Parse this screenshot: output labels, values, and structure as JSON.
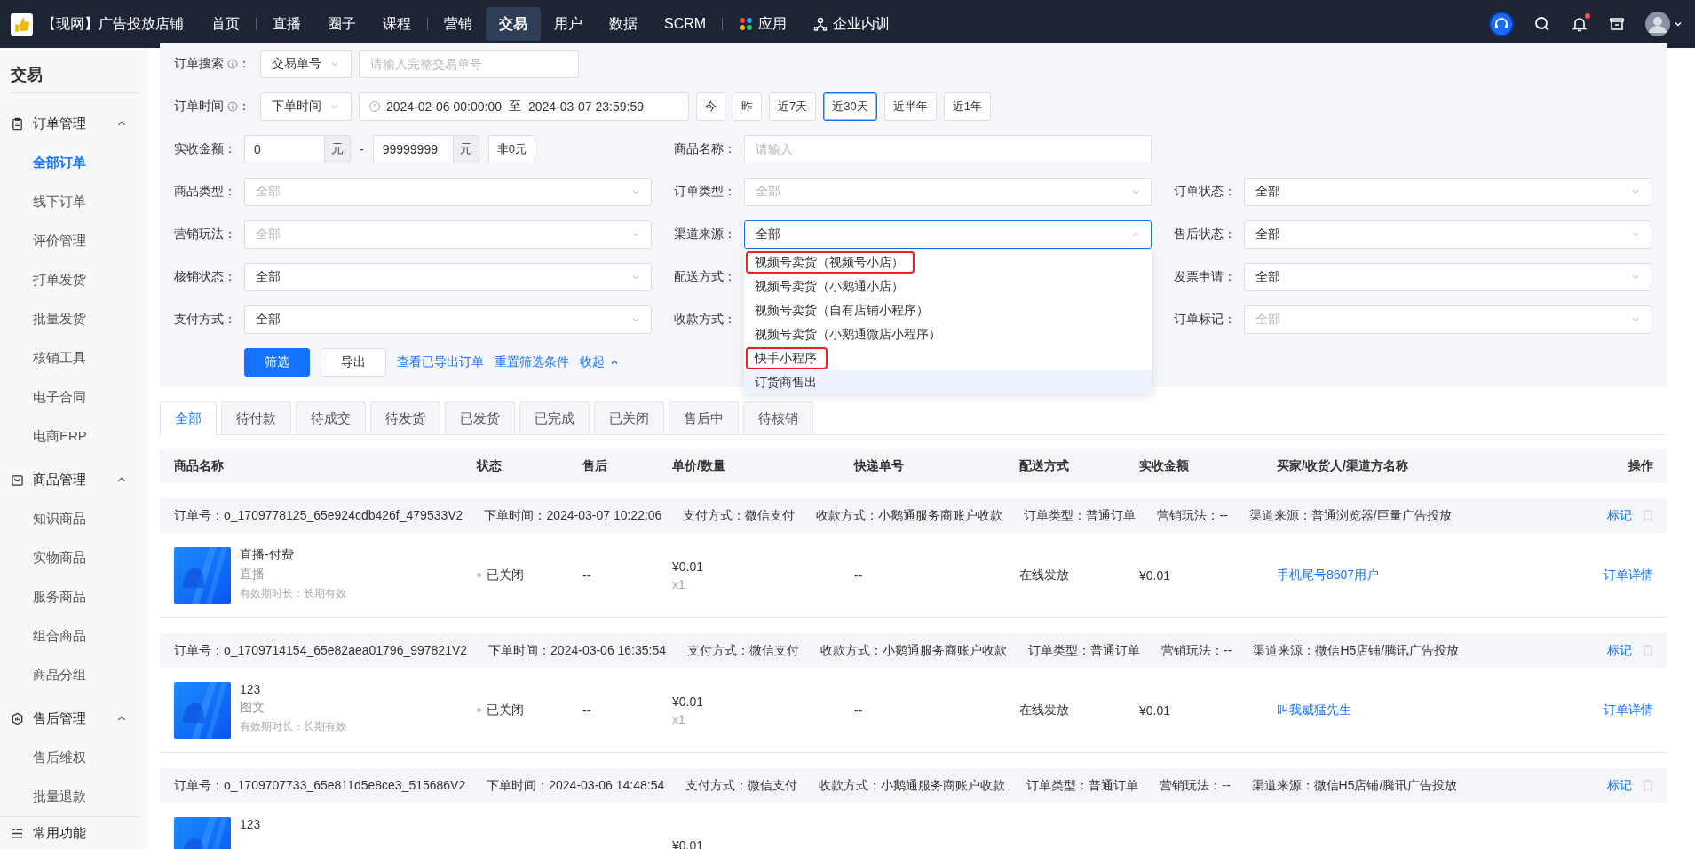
{
  "topbar": {
    "store_name": "【现网】广告投放店铺",
    "nav": [
      {
        "label": "首页",
        "selected": false,
        "divider_after": true,
        "kind": "text"
      },
      {
        "label": "直播",
        "selected": false,
        "divider_after": false,
        "kind": "text"
      },
      {
        "label": "圈子",
        "selected": false,
        "divider_after": false,
        "kind": "text"
      },
      {
        "label": "课程",
        "selected": false,
        "divider_after": true,
        "kind": "text"
      },
      {
        "label": "营销",
        "selected": false,
        "divider_after": false,
        "kind": "text"
      },
      {
        "label": "交易",
        "selected": true,
        "divider_after": false,
        "kind": "text"
      },
      {
        "label": "用户",
        "selected": false,
        "divider_after": false,
        "kind": "text"
      },
      {
        "label": "数据",
        "selected": false,
        "divider_after": false,
        "kind": "text"
      },
      {
        "label": "SCRM",
        "selected": false,
        "divider_after": true,
        "kind": "text"
      },
      {
        "label": "应用",
        "selected": false,
        "divider_after": false,
        "kind": "apps"
      },
      {
        "label": "企业内训",
        "selected": false,
        "divider_after": false,
        "kind": "training"
      }
    ],
    "notification_dot": true
  },
  "sidebar": {
    "title": "交易",
    "groups": [
      {
        "label": "订单管理",
        "expanded": true,
        "items": [
          {
            "label": "全部订单",
            "selected": true
          },
          {
            "label": "线下订单",
            "selected": false
          },
          {
            "label": "评价管理",
            "selected": false
          },
          {
            "label": "打单发货",
            "selected": false
          },
          {
            "label": "批量发货",
            "selected": false
          },
          {
            "label": "核销工具",
            "selected": false
          },
          {
            "label": "电子合同",
            "selected": false
          },
          {
            "label": "电商ERP",
            "selected": false
          }
        ]
      },
      {
        "label": "商品管理",
        "expanded": true,
        "items": [
          {
            "label": "知识商品",
            "selected": false
          },
          {
            "label": "实物商品",
            "selected": false
          },
          {
            "label": "服务商品",
            "selected": false
          },
          {
            "label": "组合商品",
            "selected": false
          },
          {
            "label": "商品分组",
            "selected": false
          }
        ]
      },
      {
        "label": "售后管理",
        "expanded": true,
        "items": [
          {
            "label": "售后维权",
            "selected": false
          },
          {
            "label": "批量退款",
            "selected": false
          }
        ]
      }
    ],
    "footer": "常用功能"
  },
  "filters": {
    "order_search": {
      "label": "订单搜索",
      "colon": "：",
      "type_select": "交易单号",
      "placeholder": "请输入完整交易单号"
    },
    "order_time": {
      "label": "订单时间",
      "colon": "：",
      "type_select": "下单时间",
      "start": "2024-02-06 00:00:00",
      "separator": "至",
      "end": "2024-03-07 23:59:59",
      "quick": [
        {
          "label": "今",
          "selected": false
        },
        {
          "label": "昨",
          "selected": false
        },
        {
          "label": "近7天",
          "selected": false
        },
        {
          "label": "近30天",
          "selected": true
        },
        {
          "label": "近半年",
          "selected": false
        },
        {
          "label": "近1年",
          "selected": false
        }
      ]
    },
    "amount": {
      "label": "实收金额：",
      "min": "0",
      "min_unit": "元",
      "dash": "-",
      "max": "99999999",
      "max_unit": "元",
      "nonzero": "非0元"
    },
    "product_name": {
      "label": "商品名称：",
      "placeholder": "请输入"
    },
    "selects": [
      {
        "label": "商品类型：",
        "placeholder": "全部",
        "open": false
      },
      {
        "label": "订单类型：",
        "placeholder": "全部",
        "open": false
      },
      {
        "label": "订单状态：",
        "value": "全部",
        "open": false
      },
      {
        "label": "营销玩法：",
        "placeholder": "全部",
        "open": false
      },
      {
        "label": "渠道来源：",
        "value": "全部",
        "open": true
      },
      {
        "label": "售后状态：",
        "value": "全部",
        "open": false
      },
      {
        "label": "核销状态：",
        "value": "全部",
        "open": false
      },
      {
        "label": "配送方式："
      },
      {
        "label": "发票申请：",
        "value": "全部",
        "open": false
      },
      {
        "label": "支付方式：",
        "value": "全部",
        "open": false
      },
      {
        "label": "收款方式："
      },
      {
        "label": "订单标记：",
        "placeholder": "全部",
        "open": false
      }
    ],
    "dropdown": {
      "options": [
        {
          "label": "视频号卖货（视频号小店）",
          "highlighted": true,
          "hovered": false
        },
        {
          "label": "视频号卖货（小鹅通小店）",
          "highlighted": false,
          "hovered": false
        },
        {
          "label": "视频号卖货（自有店铺小程序）",
          "highlighted": false,
          "hovered": false
        },
        {
          "label": "视频号卖货（小鹅通微店小程序）",
          "highlighted": false,
          "hovered": false
        },
        {
          "label": "快手小程序",
          "highlighted": true,
          "hovered": false
        },
        {
          "label": "订货商售出",
          "highlighted": false,
          "hovered": true
        }
      ]
    },
    "actions": {
      "filter": "筛选",
      "export": "导出",
      "links": [
        "查看已导出订单",
        "重置筛选条件"
      ],
      "collapse": "收起"
    }
  },
  "tabs": [
    {
      "label": "全部",
      "selected": true
    },
    {
      "label": "待付款",
      "selected": false
    },
    {
      "label": "待成交",
      "selected": false
    },
    {
      "label": "待发货",
      "selected": false
    },
    {
      "label": "已发货",
      "selected": false
    },
    {
      "label": "已完成",
      "selected": false
    },
    {
      "label": "已关闭",
      "selected": false
    },
    {
      "label": "售后中",
      "selected": false
    },
    {
      "label": "待核销",
      "selected": false
    }
  ],
  "table": {
    "columns": [
      "商品名称",
      "状态",
      "售后",
      "单价/数量",
      "快递单号",
      "配送方式",
      "实收金额",
      "买家/收货人/渠道方名称",
      "操作"
    ],
    "orders": [
      {
        "meta": [
          "订单号：o_1709778125_65e924cdb426f_479533V2",
          "下单时间：2024-03-07 10:22:06",
          "支付方式：微信支付",
          "收款方式：小鹅通服务商账户收款",
          "订单类型：普通订单",
          "营销玩法：--",
          "渠道来源：普通浏览器/巨量广告投放"
        ],
        "mark": "标记",
        "product": {
          "name": "直播-付费",
          "type": "直播",
          "validity": "有效期时长：长期有效"
        },
        "status": "已关闭",
        "after_sale": "--",
        "price": "¥0.01",
        "qty": "x1",
        "tracking": "--",
        "delivery": "在线发放",
        "amount": "¥0.01",
        "buyer": "手机尾号8607用户",
        "action": "订单详情"
      },
      {
        "meta": [
          "订单号：o_1709714154_65e82aea01796_997821V2",
          "下单时间：2024-03-06 16:35:54",
          "支付方式：微信支付",
          "收款方式：小鹅通服务商账户收款",
          "订单类型：普通订单",
          "营销玩法：--",
          "渠道来源：微信H5店铺/腾讯广告投放"
        ],
        "mark": "标记",
        "product": {
          "name": "123",
          "type": "图文",
          "validity": "有效期时长：长期有效"
        },
        "status": "已关闭",
        "after_sale": "--",
        "price": "¥0.01",
        "qty": "x1",
        "tracking": "--",
        "delivery": "在线发放",
        "amount": "¥0.01",
        "buyer": "叫我威猛先生",
        "action": "订单详情"
      },
      {
        "meta": [
          "订单号：o_1709707733_65e811d5e8ce3_515686V2",
          "下单时间：2024-03-06 14:48:54",
          "支付方式：微信支付",
          "收款方式：小鹅通服务商账户收款",
          "订单类型：普通订单",
          "营销玩法：--",
          "渠道来源：微信H5店铺/腾讯广告投放"
        ],
        "mark": "标记",
        "product": {
          "name": "123"
        },
        "price": "¥0.01"
      }
    ]
  }
}
